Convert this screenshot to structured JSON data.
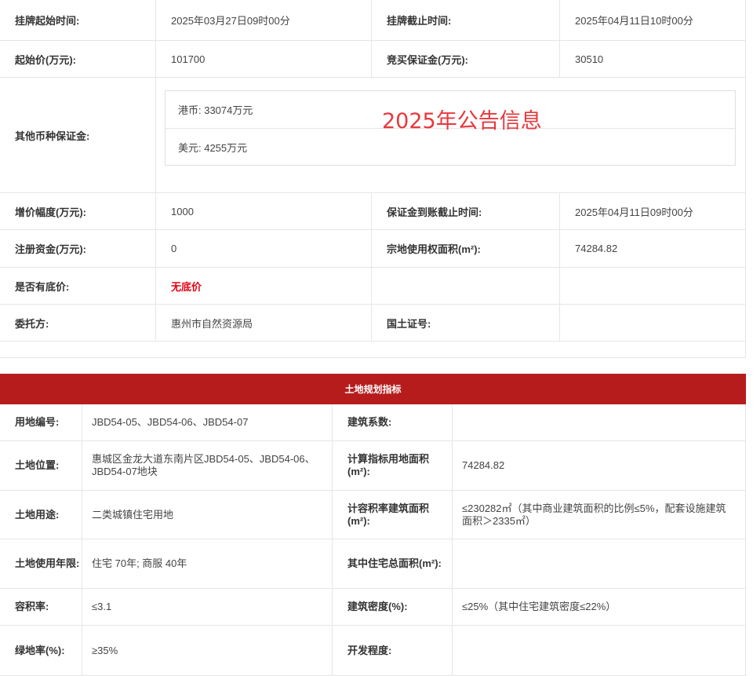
{
  "info": {
    "rows": [
      {
        "label1": "挂牌起始时间:",
        "value1": "2025年03月27日09时00分",
        "label2": "挂牌截止时间:",
        "value2": "2025年04月11日10时00分"
      },
      {
        "label1": "起始价(万元):",
        "value1": "101700",
        "label2": "竞买保证金(万元):",
        "value2": "30510"
      },
      {
        "label1": "增价幅度(万元):",
        "value1": "1000",
        "label2": "保证金到账截止时间:",
        "value2": "2025年04月11日09时00分"
      },
      {
        "label1": "注册资金(万元):",
        "value1": "0",
        "label2": "宗地使用权面积(m²):",
        "value2": "74284.82"
      },
      {
        "label1": "是否有底价:",
        "value1": "无底价",
        "label2": "",
        "value2": ""
      },
      {
        "label1": "委托方:",
        "value1": "惠州市自然资源局",
        "label2": "国土证号:",
        "value2": ""
      }
    ],
    "other_currency": {
      "label": "其他币种保证金:",
      "hkd": "港币: 33074万元",
      "usd": "美元: 4255万元"
    }
  },
  "watermark": "2025年公告信息",
  "plan": {
    "header": "土地规划指标",
    "rows": [
      {
        "label1": "用地编号:",
        "value1": "JBD54-05、JBD54-06、JBD54-07",
        "label2": "建筑系数:",
        "value2": ""
      },
      {
        "label1": "土地位置:",
        "value1": "惠城区金龙大道东南片区JBD54-05、JBD54-06、JBD54-07地块",
        "label2": "计算指标用地面积(m²):",
        "value2": "74284.82"
      },
      {
        "label1": "土地用途:",
        "value1": "二类城镇住宅用地",
        "label2": "计容积率建筑面积(m²):",
        "value2": "≤230282㎡（其中商业建筑面积的比例≤5%，配套设施建筑面积＞2335㎡）"
      },
      {
        "label1": "土地使用年限:",
        "value1": "住宅 70年; 商服 40年",
        "label2": "其中住宅总面积(m²):",
        "value2": ""
      },
      {
        "label1": "容积率:",
        "value1": "≤3.1",
        "label2": "建筑密度(%):",
        "value2": "≤25%（其中住宅建筑密度≤22%）"
      },
      {
        "label1": "绿地率(%):",
        "value1": "≥35%",
        "label2": "开发程度:",
        "value2": ""
      }
    ]
  }
}
